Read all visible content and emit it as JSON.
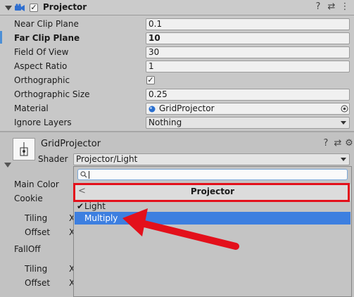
{
  "component": {
    "title": "Projector",
    "enabled_check": "✓",
    "help_icon": "?",
    "preset_icon": "⇄",
    "menu_icon": "⋮"
  },
  "properties": [
    {
      "label": "Near Clip Plane",
      "value": "0.1",
      "bold": false
    },
    {
      "label": "Far Clip Plane",
      "value": "10",
      "bold": true
    },
    {
      "label": "Field Of View",
      "value": "30",
      "bold": false
    },
    {
      "label": "Aspect Ratio",
      "value": "1",
      "bold": false
    },
    {
      "label": "Orthographic",
      "value": "✓",
      "bold": false
    },
    {
      "label": "Orthographic Size",
      "value": "0.25",
      "bold": false
    },
    {
      "label": "Material",
      "value": "GridProjector",
      "bold": false
    },
    {
      "label": "Ignore Layers",
      "value": "Nothing",
      "bold": false
    }
  ],
  "material": {
    "name": "GridProjector",
    "shader_label": "Shader",
    "shader_value": "Projector/Light",
    "help_icon": "?",
    "preset_icon": "⇄",
    "settings_icon": "⚙",
    "props": [
      "Main Color",
      "Cookie",
      "Tiling",
      "Offset",
      "FallOff",
      "Tiling",
      "Offset"
    ],
    "x_marks": [
      "X",
      "X",
      "X",
      "X"
    ]
  },
  "dropdown": {
    "search_value": "",
    "header": "Projector",
    "back_glyph": "<",
    "items": [
      {
        "label": "Light",
        "checked": true,
        "selected": false
      },
      {
        "label": "Multiply",
        "checked": false,
        "selected": true
      }
    ],
    "check_glyph": "✔"
  },
  "colors": {
    "annotation": "#e3101b",
    "selection": "#3d7fe0"
  }
}
